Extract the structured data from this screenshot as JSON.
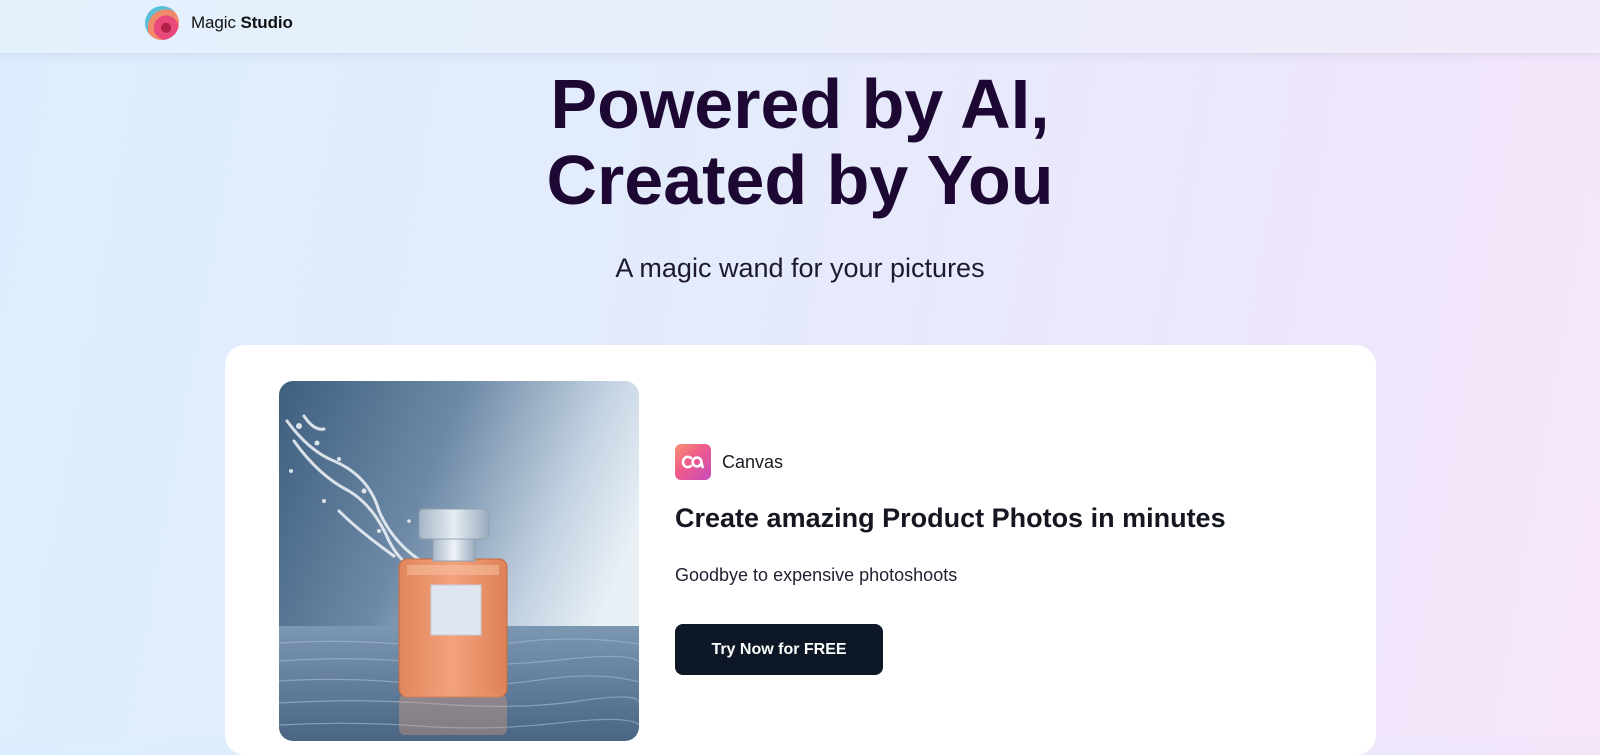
{
  "header": {
    "brand_light": "Magic",
    "brand_bold": "Studio",
    "logo_icon": "magic-studio-logo"
  },
  "hero": {
    "title_line1": "Powered by AI,",
    "title_line2": "Created by You",
    "subtitle": "A magic wand for your pictures"
  },
  "feature_card": {
    "image_subject": "perfume bottle in water",
    "app_icon": "canvas-app-icon",
    "app_name": "Canvas",
    "title": "Create amazing Product Photos in minutes",
    "description": "Goodbye to expensive photoshoots",
    "cta_label": "Try Now for FREE"
  },
  "colors": {
    "title": "#1d0733",
    "cta_background": "#0d1726",
    "card_background": "#ffffff"
  }
}
